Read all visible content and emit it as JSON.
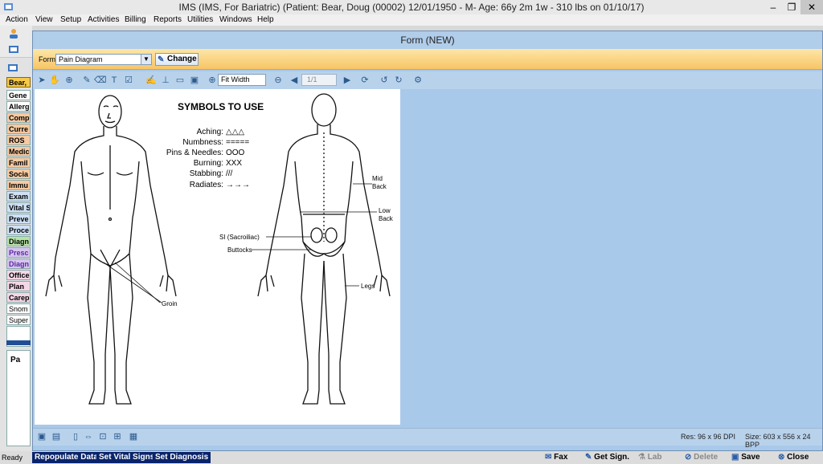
{
  "window": {
    "title": "IMS (IMS, For Bariatric)    (Patient: Bear, Doug  (00002) 12/01/1950 - M- Age: 66y 2m 1w - 310 lbs on 01/10/17)",
    "minimize": "–",
    "restore": "❐",
    "close": "✕"
  },
  "menu": [
    "Action",
    "View",
    "Setup",
    "Activities",
    "Billing",
    "Reports",
    "Utilities",
    "Windows",
    "Help"
  ],
  "sidebar": {
    "patient_tab": "Bear,",
    "items": [
      "Gene",
      "Allerg",
      "Comp",
      "Curre",
      "ROS",
      "Medic",
      "Famil",
      "Socia",
      "Immu",
      "Exam",
      "Vital S",
      "Preve",
      "Proce",
      "Diagn",
      "Presc",
      "Diagn",
      "Office",
      "Plan",
      "Carep",
      "Snom",
      "Super"
    ],
    "lower_item": "Pa"
  },
  "form_window": {
    "title": "Form (NEW)",
    "form_label": "Form:",
    "form_value": "Pain Diagram",
    "change_label": "Change",
    "zoom_value": "Fit Width",
    "page_value": "1/1",
    "resolution": "Res:  96 x 96 DPI",
    "size": "Size:  603 x 556 x 24 BPP"
  },
  "diagram": {
    "title": "SYMBOLS TO USE",
    "symbols": [
      {
        "label": "Aching:",
        "glyph": "△△△"
      },
      {
        "label": "Numbness:",
        "glyph": "====="
      },
      {
        "label": "Pins & Needles:",
        "glyph": "OOO"
      },
      {
        "label": "Burning:",
        "glyph": "XXX"
      },
      {
        "label": "Stabbing:",
        "glyph": "///"
      },
      {
        "label": "Radiates:",
        "glyph": "→→→"
      }
    ],
    "labels": {
      "mid_back_1": "Mid",
      "mid_back_2": "Back",
      "low_back_1": "Low",
      "low_back_2": "Back",
      "si": "SI (Sacroiliac)",
      "buttocks": "Buttocks",
      "legs": "Legs",
      "groin": "Groin"
    }
  },
  "status": {
    "ready": "Ready",
    "repopulate": "Repopulate Data",
    "vitals": "Set Vital Signs",
    "diagnosis": "Set Diagnosis",
    "fax": "Fax",
    "get_sign": "Get Sign.",
    "lab": "Lab",
    "delete": "Delete",
    "save": "Save",
    "close": "Close"
  },
  "colors": {
    "form_bar": "#f7c567",
    "window_bg": "#a9c9ea",
    "action_blue": "#0a246a"
  }
}
